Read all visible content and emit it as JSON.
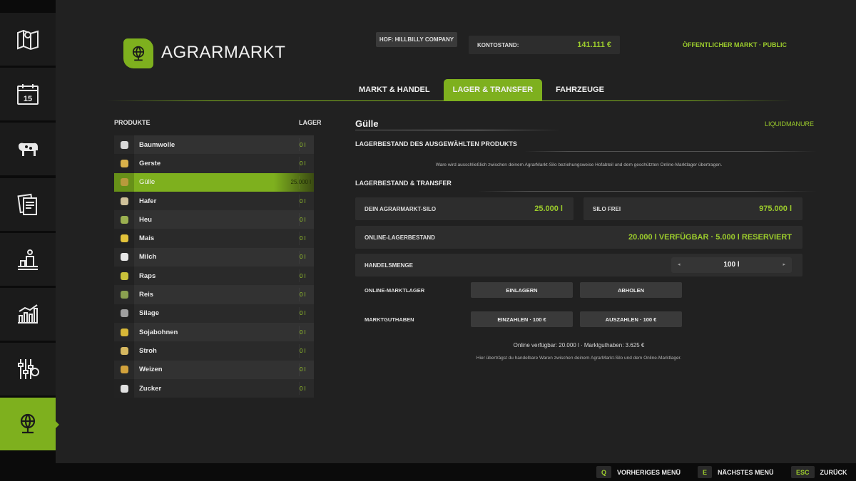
{
  "sidebar": {
    "items": [
      {
        "icon": "map-icon"
      },
      {
        "icon": "calendar-icon",
        "label": "15"
      },
      {
        "icon": "animals-icon"
      },
      {
        "icon": "contracts-icon"
      },
      {
        "icon": "production-icon"
      },
      {
        "icon": "statistics-icon"
      },
      {
        "icon": "settings-icon"
      },
      {
        "icon": "agrarmarkt-icon",
        "active": true
      }
    ]
  },
  "header": {
    "app_title": "AGRARMARKT",
    "farm": "HOF: HILLBILLY COMPANY",
    "balance_label": "KONTOSTAND:",
    "balance_value": "141.111 €",
    "market_mode": "ÖFFENTLICHER MARKT · PUBLIC"
  },
  "tabs": [
    {
      "label": "MARKT & HANDEL",
      "active": false
    },
    {
      "label": "LAGER & TRANSFER",
      "active": true
    },
    {
      "label": "FAHRZEUGE",
      "active": false
    }
  ],
  "products": {
    "header_products": "PRODUKTE",
    "header_storage": "LAGER",
    "items": [
      {
        "name": "Baumwolle",
        "qty": "0 l",
        "color": "#d8d8d8"
      },
      {
        "name": "Gerste",
        "qty": "0 l",
        "color": "#d9b14a"
      },
      {
        "name": "Gülle",
        "qty": "25.000 l",
        "color": "#b89a3c",
        "selected": true
      },
      {
        "name": "Hafer",
        "qty": "0 l",
        "color": "#cfc19a"
      },
      {
        "name": "Heu",
        "qty": "0 l",
        "color": "#9bb050"
      },
      {
        "name": "Mais",
        "qty": "0 l",
        "color": "#e2c23a"
      },
      {
        "name": "Milch",
        "qty": "0 l",
        "color": "#e8e8e8"
      },
      {
        "name": "Raps",
        "qty": "0 l",
        "color": "#c9c23a"
      },
      {
        "name": "Reis",
        "qty": "0 l",
        "color": "#8aa050"
      },
      {
        "name": "Silage",
        "qty": "0 l",
        "color": "#a0a0a0"
      },
      {
        "name": "Sojabohnen",
        "qty": "0 l",
        "color": "#d8b838"
      },
      {
        "name": "Stroh",
        "qty": "0 l",
        "color": "#d6b860"
      },
      {
        "name": "Weizen",
        "qty": "0 l",
        "color": "#d2a23c"
      },
      {
        "name": "Zucker",
        "qty": "0 l",
        "color": "#e0e0e0"
      }
    ]
  },
  "detail": {
    "product_name": "Gülle",
    "product_type": "LIQUIDMANURE",
    "section_stock_title": "LAGERBESTAND DES AUSGEWÄHLTEN PRODUKTS",
    "section_stock_note": "Ware wird ausschließlich zwischen deinem AgrarMarkt-Silo beziehungsweise Hofabteil und dem geschützten Online-Marktlager übertragen.",
    "section_transfer_title": "LAGERBESTAND & TRANSFER",
    "silo_label": "DEIN AGRARMARKT-SILO",
    "silo_value": "25.000 l",
    "free_label": "SILO FREI",
    "free_value": "975.000 l",
    "online_label": "ONLINE-LAGERBESTAND",
    "online_value": "20.000 l VERFÜGBAR · 5.000 l RESERVIERT",
    "amount_label": "HANDELSMENGE",
    "amount_value": "100 l",
    "chev_left": "◂",
    "chev_right": "▸",
    "warehouse_label": "ONLINE-MARKTLAGER",
    "btn_store": "EINLAGERN",
    "btn_fetch": "ABHOLEN",
    "credit_label": "MARKTGUTHABEN",
    "btn_deposit": "EINZAHLEN · 100 €",
    "btn_withdraw": "AUSZAHLEN · 100 €",
    "summary": "Online verfügbar: 20.000 l · Marktguthaben: 3.625 €",
    "help": "Hier überträgst du handelbare Waren zwischen deinem AgrarMarkt-Silo und dem Online-Marktlager."
  },
  "bottom": {
    "prev_key": "Q",
    "prev_label": "VORHERIGES MENÜ",
    "next_key": "E",
    "next_label": "NÄCHSTES MENÜ",
    "back_key": "ESC",
    "back_label": "ZURÜCK"
  },
  "colors": {
    "accent": "#7eb01e",
    "accent_text": "#9ccc2c",
    "background": "#212121"
  }
}
